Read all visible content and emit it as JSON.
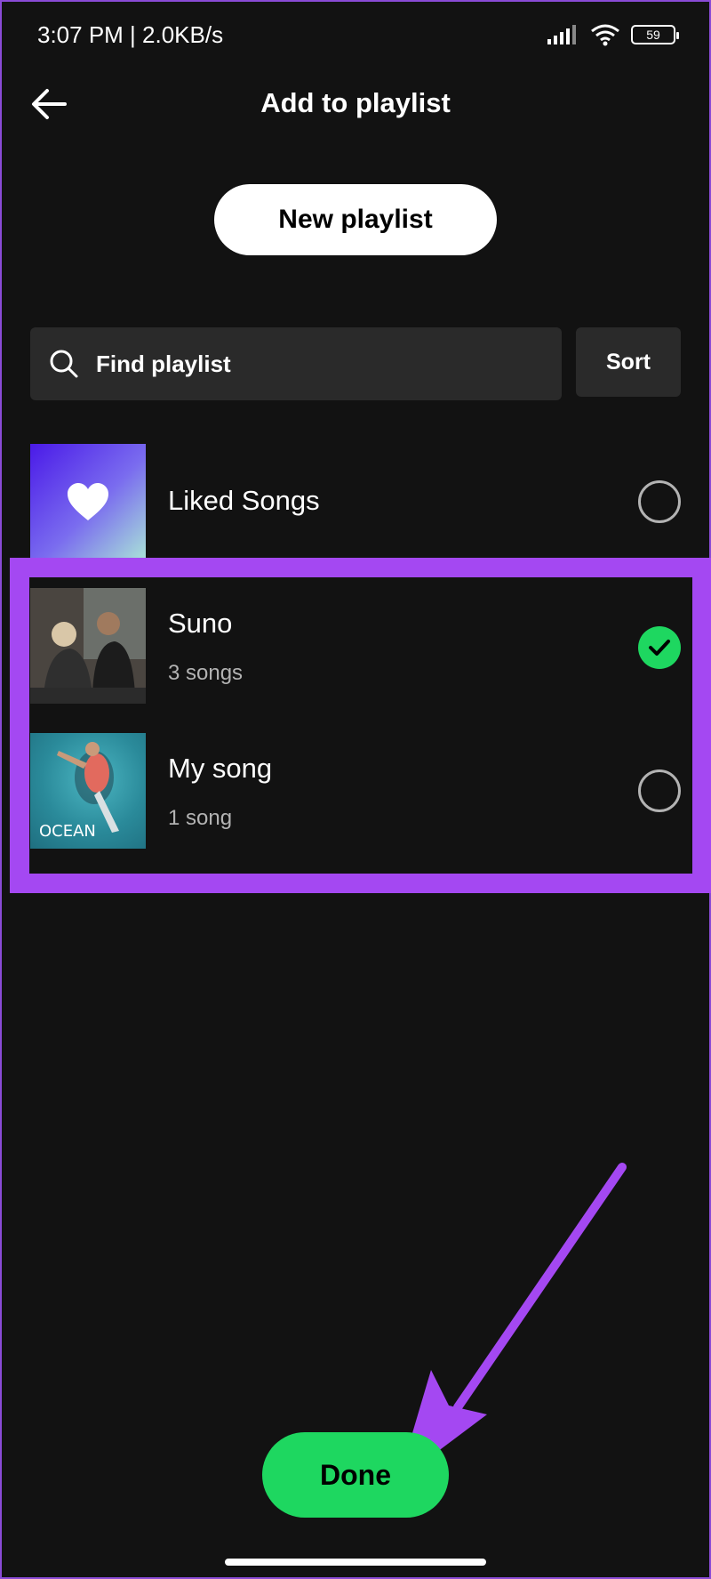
{
  "status_bar": {
    "time_speed": "3:07 PM | 2.0KB/s",
    "battery": "59"
  },
  "header": {
    "title": "Add to playlist"
  },
  "actions": {
    "new_playlist_label": "New playlist",
    "search_placeholder": "Find playlist",
    "sort_label": "Sort",
    "done_label": "Done"
  },
  "playlists": [
    {
      "title": "Liked Songs",
      "subtitle": "",
      "selected": false,
      "art_icon": "heart-icon"
    },
    {
      "title": "Suno",
      "subtitle": "3 songs",
      "selected": true,
      "art_icon": "photo-couple"
    },
    {
      "title": "My song",
      "subtitle": "1 song",
      "selected": false,
      "art_icon": "photo-ocean",
      "art_text": "OCEAN"
    }
  ],
  "colors": {
    "accent_green": "#1ed760",
    "highlight_purple": "#a448f2",
    "background": "#121212"
  }
}
